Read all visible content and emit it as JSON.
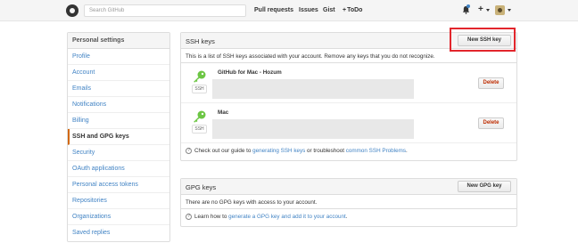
{
  "header": {
    "search_placeholder": "Search GitHub",
    "nav": [
      "Pull requests",
      "Issues",
      "Gist",
      "ToDo"
    ],
    "plus": "+"
  },
  "sidebar": {
    "title": "Personal settings",
    "items": [
      {
        "label": "Profile"
      },
      {
        "label": "Account"
      },
      {
        "label": "Emails"
      },
      {
        "label": "Notifications"
      },
      {
        "label": "Billing"
      },
      {
        "label": "SSH and GPG keys",
        "selected": true
      },
      {
        "label": "Security"
      },
      {
        "label": "OAuth applications"
      },
      {
        "label": "Personal access tokens"
      },
      {
        "label": "Repositories"
      },
      {
        "label": "Organizations"
      },
      {
        "label": "Saved replies"
      }
    ]
  },
  "ssh": {
    "title": "SSH keys",
    "new_button": "New SSH key",
    "description": "This is a list of SSH keys associated with your account. Remove any keys that you do not recognize.",
    "keys": [
      {
        "title": "GitHub for Mac - Hozum",
        "type": "SSH",
        "delete": "Delete"
      },
      {
        "title": "Mac",
        "type": "SSH",
        "delete": "Delete"
      }
    ],
    "footer_prefix": "Check out our guide to ",
    "footer_link1": "generating SSH keys",
    "footer_mid": " or troubleshoot ",
    "footer_link2": "common SSH Problems",
    "footer_suffix": "."
  },
  "gpg": {
    "title": "GPG keys",
    "new_button": "New GPG key",
    "description": "There are no GPG keys with access to your account.",
    "footer_prefix": "Learn how to ",
    "footer_link": "generate a GPG key and add it to your account",
    "footer_suffix": "."
  },
  "colors": {
    "link": "#4183c4",
    "key_green": "#6cc644",
    "delete_red": "#bd2c00",
    "highlight_red": "#e2262c"
  },
  "icons": {
    "logo": "github-octocat-icon",
    "bell": "bell-icon",
    "key": "key-icon",
    "help": "question-circle-icon"
  }
}
